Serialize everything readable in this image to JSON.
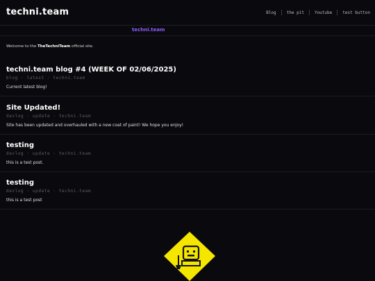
{
  "site": {
    "logo": "techni.team",
    "subtitle": "techni.team"
  },
  "nav": {
    "items": [
      {
        "label": "Blog"
      },
      {
        "label": "the pit"
      },
      {
        "label": "Youtube"
      },
      {
        "label": "test button"
      }
    ]
  },
  "welcome": {
    "prefix": "Welcome to the ",
    "brand": "TheTechniTeam",
    "suffix": " official site."
  },
  "posts": [
    {
      "title": "techni.team blog #4 (WEEK OF 02/06/2025)",
      "tags": "blog · latest · techni.team",
      "summary": "Current latest blog!"
    },
    {
      "title": "Site Updated!",
      "tags": "devlog · update · techni.team",
      "summary": "Site has been updated and overhauled with a new coat of paint! We hope you enjoy!"
    },
    {
      "title": "testing",
      "tags": "devlog · update · techni.team",
      "summary": "this is a test post."
    },
    {
      "title": "testing",
      "tags": "devlog · update · techni.team",
      "summary": "this is a test post"
    }
  ],
  "colors": {
    "background": "#0a0a0e",
    "accent": "#8a5cf6",
    "mascot": "#f5e600"
  },
  "icons": {
    "mascot": "techni-mascot-icon"
  }
}
